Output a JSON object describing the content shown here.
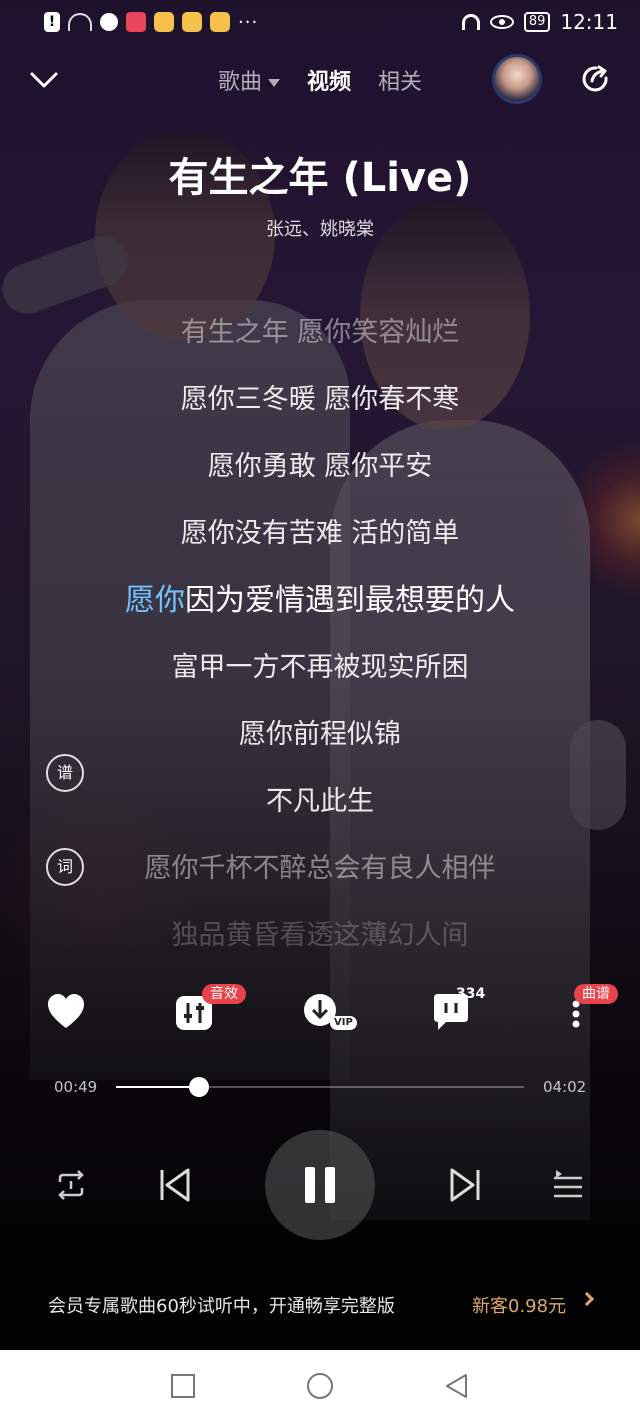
{
  "status_bar": {
    "time": "12:11",
    "battery": "89",
    "overflow": "···"
  },
  "nav": {
    "tabs": [
      {
        "label": "歌曲"
      },
      {
        "label": "视频"
      },
      {
        "label": "相关"
      }
    ],
    "active_tab": "视频"
  },
  "song": {
    "title": "有生之年 (Live)",
    "artists": "张远、姚晓棠"
  },
  "lyrics": {
    "lines": [
      "有生之年 愿你笑容灿烂",
      "愿你三冬暖 愿你春不寒",
      "愿你勇敢 愿你平安",
      "愿你没有苦难 活的简单",
      "因为爱情遇到最想要的人",
      "富甲一方不再被现实所困",
      "愿你前程似锦",
      "不凡此生",
      "愿你千杯不醉总会有良人相伴",
      "独品黄昏看透这薄幻人间"
    ],
    "current_highlight": "愿你"
  },
  "side_buttons": {
    "sheet": "谱",
    "lyric": "词"
  },
  "actions": {
    "sound_effect_badge": "音效",
    "download_badge": "VIP",
    "comment_count": "334",
    "score_badge": "曲谱"
  },
  "progress": {
    "elapsed": "00:49",
    "total": "04:02",
    "fraction": 0.2025
  },
  "vip_banner": {
    "text": "会员专属歌曲60秒试听中，开通畅享完整版",
    "cta": "新客0.98元"
  },
  "colors": {
    "highlight": "#6fc3ff",
    "badge": "#e8434a",
    "cta": "#e0a56a"
  }
}
